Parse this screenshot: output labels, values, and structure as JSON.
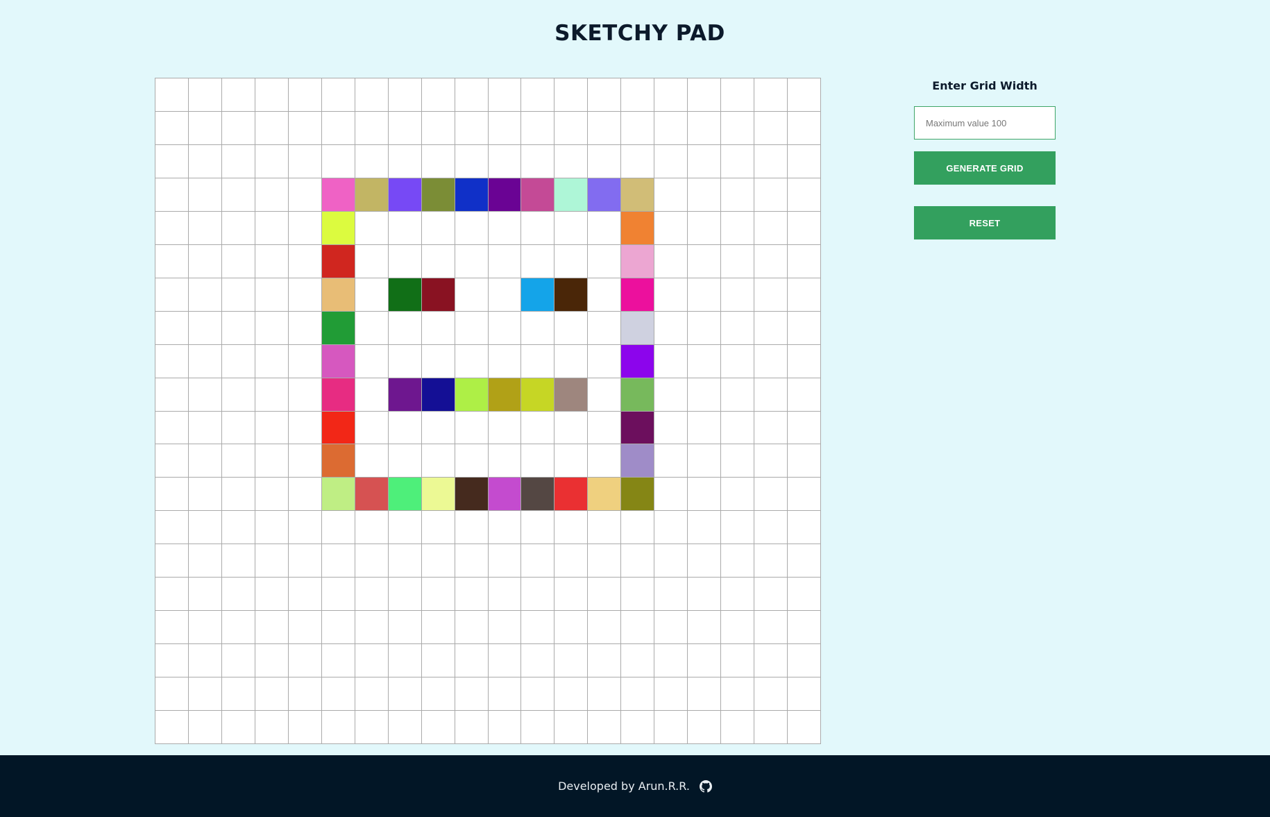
{
  "app": {
    "title": "SKETCHY PAD"
  },
  "grid": {
    "size": 20,
    "cell_default_color": "#ffffff",
    "border_color": "#aaaaaa",
    "colored_cells": [
      {
        "row": 3,
        "col": 5,
        "color": "#ef62c5"
      },
      {
        "row": 3,
        "col": 6,
        "color": "#c2b564"
      },
      {
        "row": 3,
        "col": 7,
        "color": "#7749f5"
      },
      {
        "row": 3,
        "col": 8,
        "color": "#7b8d36"
      },
      {
        "row": 3,
        "col": 9,
        "color": "#1030c8"
      },
      {
        "row": 3,
        "col": 10,
        "color": "#6a0394"
      },
      {
        "row": 3,
        "col": 11,
        "color": "#c44a96"
      },
      {
        "row": 3,
        "col": 12,
        "color": "#aef6d7"
      },
      {
        "row": 3,
        "col": 13,
        "color": "#826cf0"
      },
      {
        "row": 3,
        "col": 14,
        "color": "#d1bd77"
      },
      {
        "row": 4,
        "col": 5,
        "color": "#dcfb3f"
      },
      {
        "row": 4,
        "col": 14,
        "color": "#f08232"
      },
      {
        "row": 5,
        "col": 5,
        "color": "#d0261f"
      },
      {
        "row": 5,
        "col": 14,
        "color": "#eca6d2"
      },
      {
        "row": 6,
        "col": 5,
        "color": "#e8bd76"
      },
      {
        "row": 6,
        "col": 7,
        "color": "#116f17"
      },
      {
        "row": 6,
        "col": 8,
        "color": "#891222"
      },
      {
        "row": 6,
        "col": 11,
        "color": "#14a4e9"
      },
      {
        "row": 6,
        "col": 12,
        "color": "#4a2608"
      },
      {
        "row": 6,
        "col": 14,
        "color": "#ec109d"
      },
      {
        "row": 7,
        "col": 5,
        "color": "#219c36"
      },
      {
        "row": 7,
        "col": 14,
        "color": "#cfd1e0"
      },
      {
        "row": 8,
        "col": 5,
        "color": "#d658bf"
      },
      {
        "row": 8,
        "col": 14,
        "color": "#8c05ec"
      },
      {
        "row": 9,
        "col": 5,
        "color": "#e72c82"
      },
      {
        "row": 9,
        "col": 7,
        "color": "#6e178f"
      },
      {
        "row": 9,
        "col": 8,
        "color": "#140f95"
      },
      {
        "row": 9,
        "col": 9,
        "color": "#aeef46"
      },
      {
        "row": 9,
        "col": 10,
        "color": "#b1a117"
      },
      {
        "row": 9,
        "col": 11,
        "color": "#c6d625"
      },
      {
        "row": 9,
        "col": 12,
        "color": "#9e867e"
      },
      {
        "row": 9,
        "col": 14,
        "color": "#77b95c"
      },
      {
        "row": 10,
        "col": 5,
        "color": "#f22717"
      },
      {
        "row": 10,
        "col": 14,
        "color": "#6c0f5d"
      },
      {
        "row": 11,
        "col": 5,
        "color": "#dc6b32"
      },
      {
        "row": 11,
        "col": 14,
        "color": "#9f8cc8"
      },
      {
        "row": 12,
        "col": 5,
        "color": "#bfee84"
      },
      {
        "row": 12,
        "col": 6,
        "color": "#d65252"
      },
      {
        "row": 12,
        "col": 7,
        "color": "#4eef7a"
      },
      {
        "row": 12,
        "col": 8,
        "color": "#ecf994"
      },
      {
        "row": 12,
        "col": 9,
        "color": "#452a1e"
      },
      {
        "row": 12,
        "col": 10,
        "color": "#c44bcf"
      },
      {
        "row": 12,
        "col": 11,
        "color": "#544743"
      },
      {
        "row": 12,
        "col": 12,
        "color": "#ea3032"
      },
      {
        "row": 12,
        "col": 13,
        "color": "#efd07f"
      },
      {
        "row": 12,
        "col": 14,
        "color": "#858615"
      }
    ]
  },
  "controls": {
    "label": "Enter Grid Width",
    "input_value": "",
    "input_placeholder": "Maximum value 100",
    "generate_label": "GENERATE GRID",
    "reset_label": "RESET",
    "button_color": "#33a05e"
  },
  "footer": {
    "text": "Developed by Arun.R.R.",
    "icon": "github-icon",
    "background": "#021626"
  },
  "colors": {
    "page_background": "#e2f8fb",
    "title_color": "#0c1a2b"
  }
}
